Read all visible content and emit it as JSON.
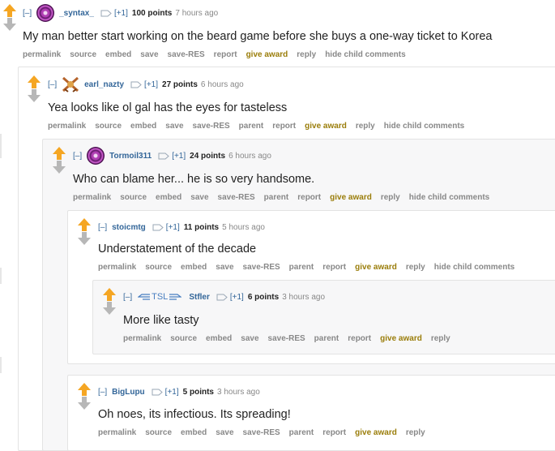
{
  "colors": {
    "upvote": "#f5a623",
    "downvote": "#b7b7b7",
    "author": "#336699",
    "award": "#9a7d0a",
    "action_text": "#888888",
    "odd_comment_bg": "#f7f7f8"
  },
  "comments": [
    {
      "expand": "[–]",
      "author": "_syntax_",
      "avatar_icon": "spiral-avatar",
      "vote_weight": "[+1]",
      "points": "100 points",
      "time": "7 hours ago",
      "body": "My man better start working on the beard game before she buys a one-way ticket to Korea",
      "actions": [
        "permalink",
        "source",
        "embed",
        "save",
        "save-RES",
        "report",
        "give award",
        "reply",
        "hide child comments"
      ]
    },
    {
      "expand": "[–]",
      "author": "earl_nazty",
      "avatar_icon": "crossed-swords-icon",
      "vote_weight": "[+1]",
      "points": "27 points",
      "time": "6 hours ago",
      "body": "Yea looks like ol gal has the eyes for tasteless",
      "actions": [
        "permalink",
        "source",
        "embed",
        "save",
        "save-RES",
        "parent",
        "report",
        "give award",
        "reply",
        "hide child comments"
      ]
    },
    {
      "expand": "[–]",
      "author": "Tormoil311",
      "avatar_icon": "spiral-avatar",
      "vote_weight": "[+1]",
      "points": "24 points",
      "time": "6 hours ago",
      "body": "Who can blame her... he is so very handsome.",
      "actions": [
        "permalink",
        "source",
        "embed",
        "save",
        "save-RES",
        "parent",
        "report",
        "give award",
        "reply",
        "hide child comments"
      ]
    },
    {
      "expand": "[–]",
      "author": "stoicmtg",
      "vote_weight": "[+1]",
      "points": "11 points",
      "time": "5 hours ago",
      "body": "Understatement of the decade",
      "actions": [
        "permalink",
        "source",
        "embed",
        "save",
        "save-RES",
        "parent",
        "report",
        "give award",
        "reply",
        "hide child comments"
      ]
    },
    {
      "expand": "[–]",
      "flair": "TSL",
      "author": "Stfler",
      "vote_weight": "[+1]",
      "points": "6 points",
      "time": "3 hours ago",
      "body": "More like tasty",
      "actions": [
        "permalink",
        "source",
        "embed",
        "save",
        "save-RES",
        "parent",
        "report",
        "give award",
        "reply"
      ]
    },
    {
      "expand": "[–]",
      "author": "BigLupu",
      "vote_weight": "[+1]",
      "points": "5 points",
      "time": "3 hours ago",
      "body": "Oh noes, its infectious. Its spreading!",
      "actions": [
        "permalink",
        "source",
        "embed",
        "save",
        "save-RES",
        "parent",
        "report",
        "give award",
        "reply"
      ]
    }
  ]
}
